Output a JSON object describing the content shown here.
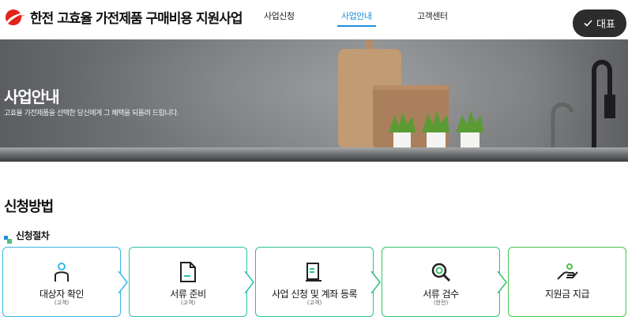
{
  "header": {
    "logo_text": "한전 고효율 가전제품 구매비용 지원사업",
    "nav": [
      {
        "label": "사업신청",
        "active": false
      },
      {
        "label": "사업안내",
        "active": true
      },
      {
        "label": "고객센터",
        "active": false
      }
    ],
    "rep_button_label": "대표"
  },
  "hero": {
    "title": "사업안내",
    "subtitle": "고효율 가전제품을 선택한 당신에게 그 혜택을 되돌려 드립니다."
  },
  "section": {
    "title": "신청방법",
    "subtitle": "신청절차"
  },
  "steps": [
    {
      "label": "대상자 확인",
      "note": "(고객)",
      "icon": "person-icon",
      "color": "#38b6e6"
    },
    {
      "label": "서류 준비",
      "note": "(고객)",
      "icon": "document-icon",
      "color": "#2cc2a8"
    },
    {
      "label": "사업 신청 및 계좌 등록",
      "note": "(고객)",
      "icon": "form-icon",
      "color": "#2cc08a"
    },
    {
      "label": "서류 검수",
      "note": "(한전)",
      "icon": "magnifier-icon",
      "color": "#34c266"
    },
    {
      "label": "지원금 지급",
      "note": "",
      "icon": "hand-money-icon",
      "color": "#49c24a"
    }
  ],
  "colors": {
    "accent": "#1f8fd6",
    "logo_red": "#e2231a"
  }
}
